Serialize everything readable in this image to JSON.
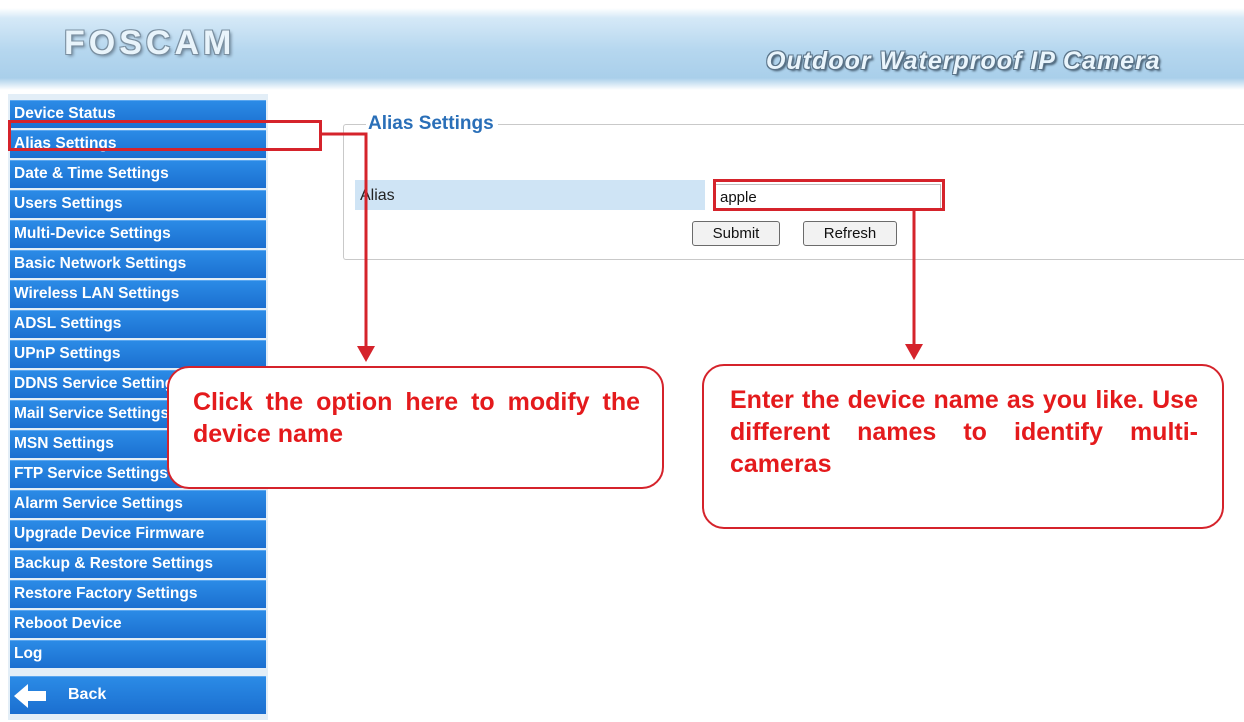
{
  "header": {
    "logo_text": "FOSCAM",
    "product_title": "Outdoor Waterproof IP Camera"
  },
  "sidebar": {
    "items": [
      {
        "label": "Device Status"
      },
      {
        "label": "Alias Settings"
      },
      {
        "label": "Date & Time Settings"
      },
      {
        "label": "Users Settings"
      },
      {
        "label": "Multi-Device Settings"
      },
      {
        "label": "Basic Network Settings"
      },
      {
        "label": "Wireless LAN Settings"
      },
      {
        "label": "ADSL Settings"
      },
      {
        "label": "UPnP Settings"
      },
      {
        "label": "DDNS Service Settings"
      },
      {
        "label": "Mail Service Settings"
      },
      {
        "label": "MSN Settings"
      },
      {
        "label": "FTP Service Settings"
      },
      {
        "label": "Alarm Service Settings"
      },
      {
        "label": "Upgrade Device Firmware"
      },
      {
        "label": "Backup & Restore Settings"
      },
      {
        "label": "Restore Factory Settings"
      },
      {
        "label": "Reboot Device"
      },
      {
        "label": "Log"
      }
    ],
    "back_label": "Back",
    "back_icon": "arrow-left-icon"
  },
  "main": {
    "section_title": "Alias Settings",
    "alias_label": "Alias",
    "alias_value": "apple",
    "submit_label": "Submit",
    "refresh_label": "Refresh"
  },
  "annotations": {
    "left_callout": "Click the option here to modify the device name",
    "right_callout": "Enter the device name as you like. Use different names to identify multi-cameras"
  },
  "colors": {
    "menu_blue": "#1b6fd0",
    "highlight_red": "#d5232b",
    "callout_text": "#e41a1c",
    "section_title": "#2a6fb8"
  }
}
